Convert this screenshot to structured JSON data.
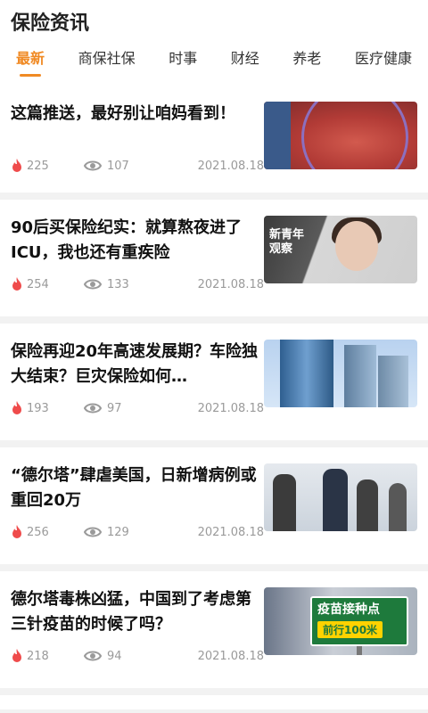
{
  "header": {
    "title": "保险资讯",
    "tabs": [
      {
        "label": "最新",
        "active": true
      },
      {
        "label": "商保社保",
        "active": false
      },
      {
        "label": "时事",
        "active": false
      },
      {
        "label": "财经",
        "active": false
      },
      {
        "label": "养老",
        "active": false
      },
      {
        "label": "医疗健康",
        "active": false
      }
    ]
  },
  "accent_color": "#f08a24",
  "articles": [
    {
      "title": "这篇推送，最好别让咱妈看到！",
      "heat": "225",
      "views": "107",
      "date": "2021.08.18",
      "thumb_icon": "skin-rash-photo"
    },
    {
      "title": "90后买保险纪实：就算熬夜进了ICU，我也还有重疾险",
      "heat": "254",
      "views": "133",
      "date": "2021.08.18",
      "thumb_icon": "young-person-photo",
      "thumb_badge": "新青年观察"
    },
    {
      "title": "保险再迎20年高速发展期？车险独大结束？巨灾保险如何…",
      "heat": "193",
      "views": "97",
      "date": "2021.08.18",
      "thumb_icon": "office-buildings-photo"
    },
    {
      "title": "“德尔塔”肆虐美国，日新增病例或重回20万",
      "heat": "256",
      "views": "129",
      "date": "2021.08.18",
      "thumb_icon": "airport-crowd-photo"
    },
    {
      "title": "德尔塔毒株凶猛，中国到了考虑第三针疫苗的时候了吗？",
      "heat": "218",
      "views": "94",
      "date": "2021.08.18",
      "thumb_icon": "vaccine-sign-photo",
      "thumb_sign_l1": "疫苗接种点",
      "thumb_sign_l2": "前行100米"
    }
  ]
}
